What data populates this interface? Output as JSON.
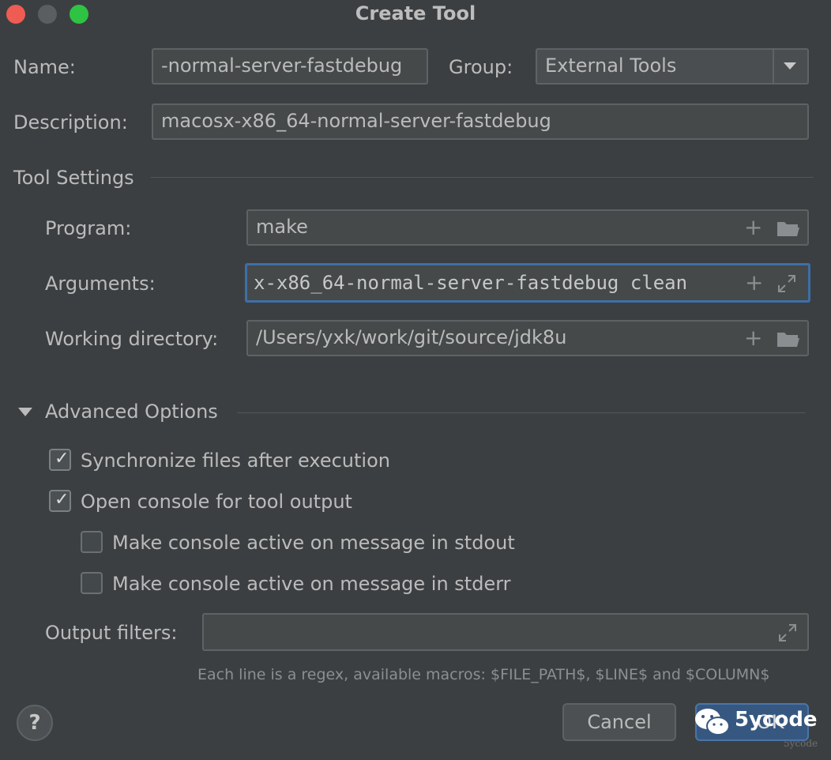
{
  "window": {
    "title": "Create Tool",
    "traffic_lights": {
      "close": "#ee5c54",
      "minimize": "#5b5e60",
      "zoom": "#2ec343"
    }
  },
  "name": {
    "label": "Name:",
    "value": "-normal-server-fastdebug"
  },
  "group": {
    "label": "Group:",
    "value": "External Tools"
  },
  "description": {
    "label": "Description:",
    "value": "macosx-x86_64-normal-server-fastdebug"
  },
  "tool_settings": {
    "header": "Tool Settings",
    "program": {
      "label": "Program:",
      "value": "make"
    },
    "arguments": {
      "label": "Arguments:",
      "value": "x-x86_64-normal-server-fastdebug  clean"
    },
    "working_directory": {
      "label": "Working directory:",
      "value": "/Users/yxk/work/git/source/jdk8u"
    }
  },
  "advanced": {
    "header": "Advanced Options",
    "sync_files": {
      "label": "Synchronize files after execution",
      "checked": true
    },
    "open_console": {
      "label": "Open console for tool output",
      "checked": true
    },
    "active_stdout": {
      "label": "Make console active on message in stdout",
      "checked": false
    },
    "active_stderr": {
      "label": "Make console active on message in stderr",
      "checked": false
    },
    "output_filters": {
      "label": "Output filters:",
      "value": ""
    },
    "hint": "Each line is a regex, available macros: $FILE_PATH$, $LINE$ and $COLUMN$"
  },
  "footer": {
    "help": "?",
    "cancel": "Cancel",
    "ok": "OK",
    "watermark": "5ycode",
    "watermark_small": "5ycode"
  },
  "colors": {
    "accent": "#365880",
    "focus": "#3d6fa6"
  }
}
